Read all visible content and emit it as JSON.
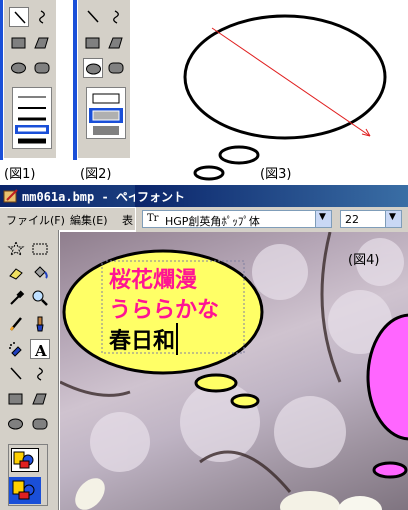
{
  "figures": {
    "fig1_caption": "(図1)",
    "fig2_caption": "(図2)",
    "fig3_caption": "(図3)",
    "fig4_caption": "(図4)"
  },
  "window": {
    "title": "mm061a.bmp - ペイント"
  },
  "menu": {
    "file": "ファイル(F)",
    "edit": "編集(E)",
    "view": "表"
  },
  "font_toolbar": {
    "title": "フォント",
    "font_name": "HGP創英角ﾎﾟｯﾌﾟ体",
    "font_size": "22"
  },
  "canvas_text": {
    "line1": "桜花爛漫",
    "line2": "うららかな",
    "line3": "春日和"
  },
  "colors": {
    "accent_blue": "#1a4fd8",
    "title_blue": "#0a246a",
    "bubble_yellow": "#ffff66",
    "bubble_pink": "#ff66ff",
    "text_pink": "#ff1493"
  },
  "icons": [
    "select-icon",
    "free-form-line-icon",
    "rectangle-icon",
    "polygon-icon",
    "ellipse-icon",
    "rounded-rect-icon",
    "line-width-icon",
    "fill-style-icon",
    "star-select-icon",
    "eraser-icon",
    "fill-bucket-icon",
    "eyedropper-icon",
    "magnifier-icon",
    "pencil-icon",
    "brush-icon",
    "airbrush-icon",
    "text-icon",
    "curve-icon"
  ]
}
